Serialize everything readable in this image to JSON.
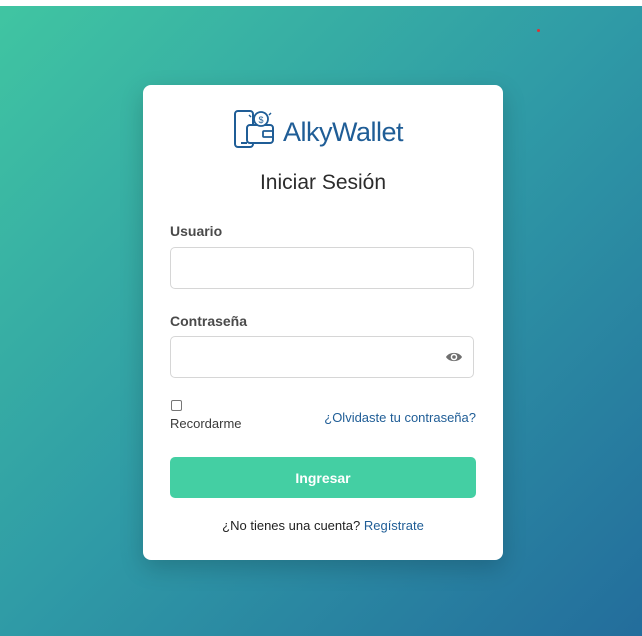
{
  "brand": {
    "name": "AlkyWallet",
    "color": "#1f5d96"
  },
  "login": {
    "title": "Iniciar Sesión",
    "username_label": "Usuario",
    "username_value": "",
    "password_label": "Contraseña",
    "password_value": "",
    "remember_label": "Recordarme",
    "remember_checked": false,
    "forgot_link": "¿Olvidaste tu contraseña?",
    "submit_label": "Ingresar",
    "signup_prompt": "¿No tienes una cuenta?",
    "signup_link": "Regístrate"
  },
  "colors": {
    "background_start": "#40c5a2",
    "background_end": "#236d9c",
    "submit_button": "#44cfa3",
    "link": "#1f5d96"
  },
  "icons": [
    "wallet-logo-icon",
    "eye-icon"
  ]
}
